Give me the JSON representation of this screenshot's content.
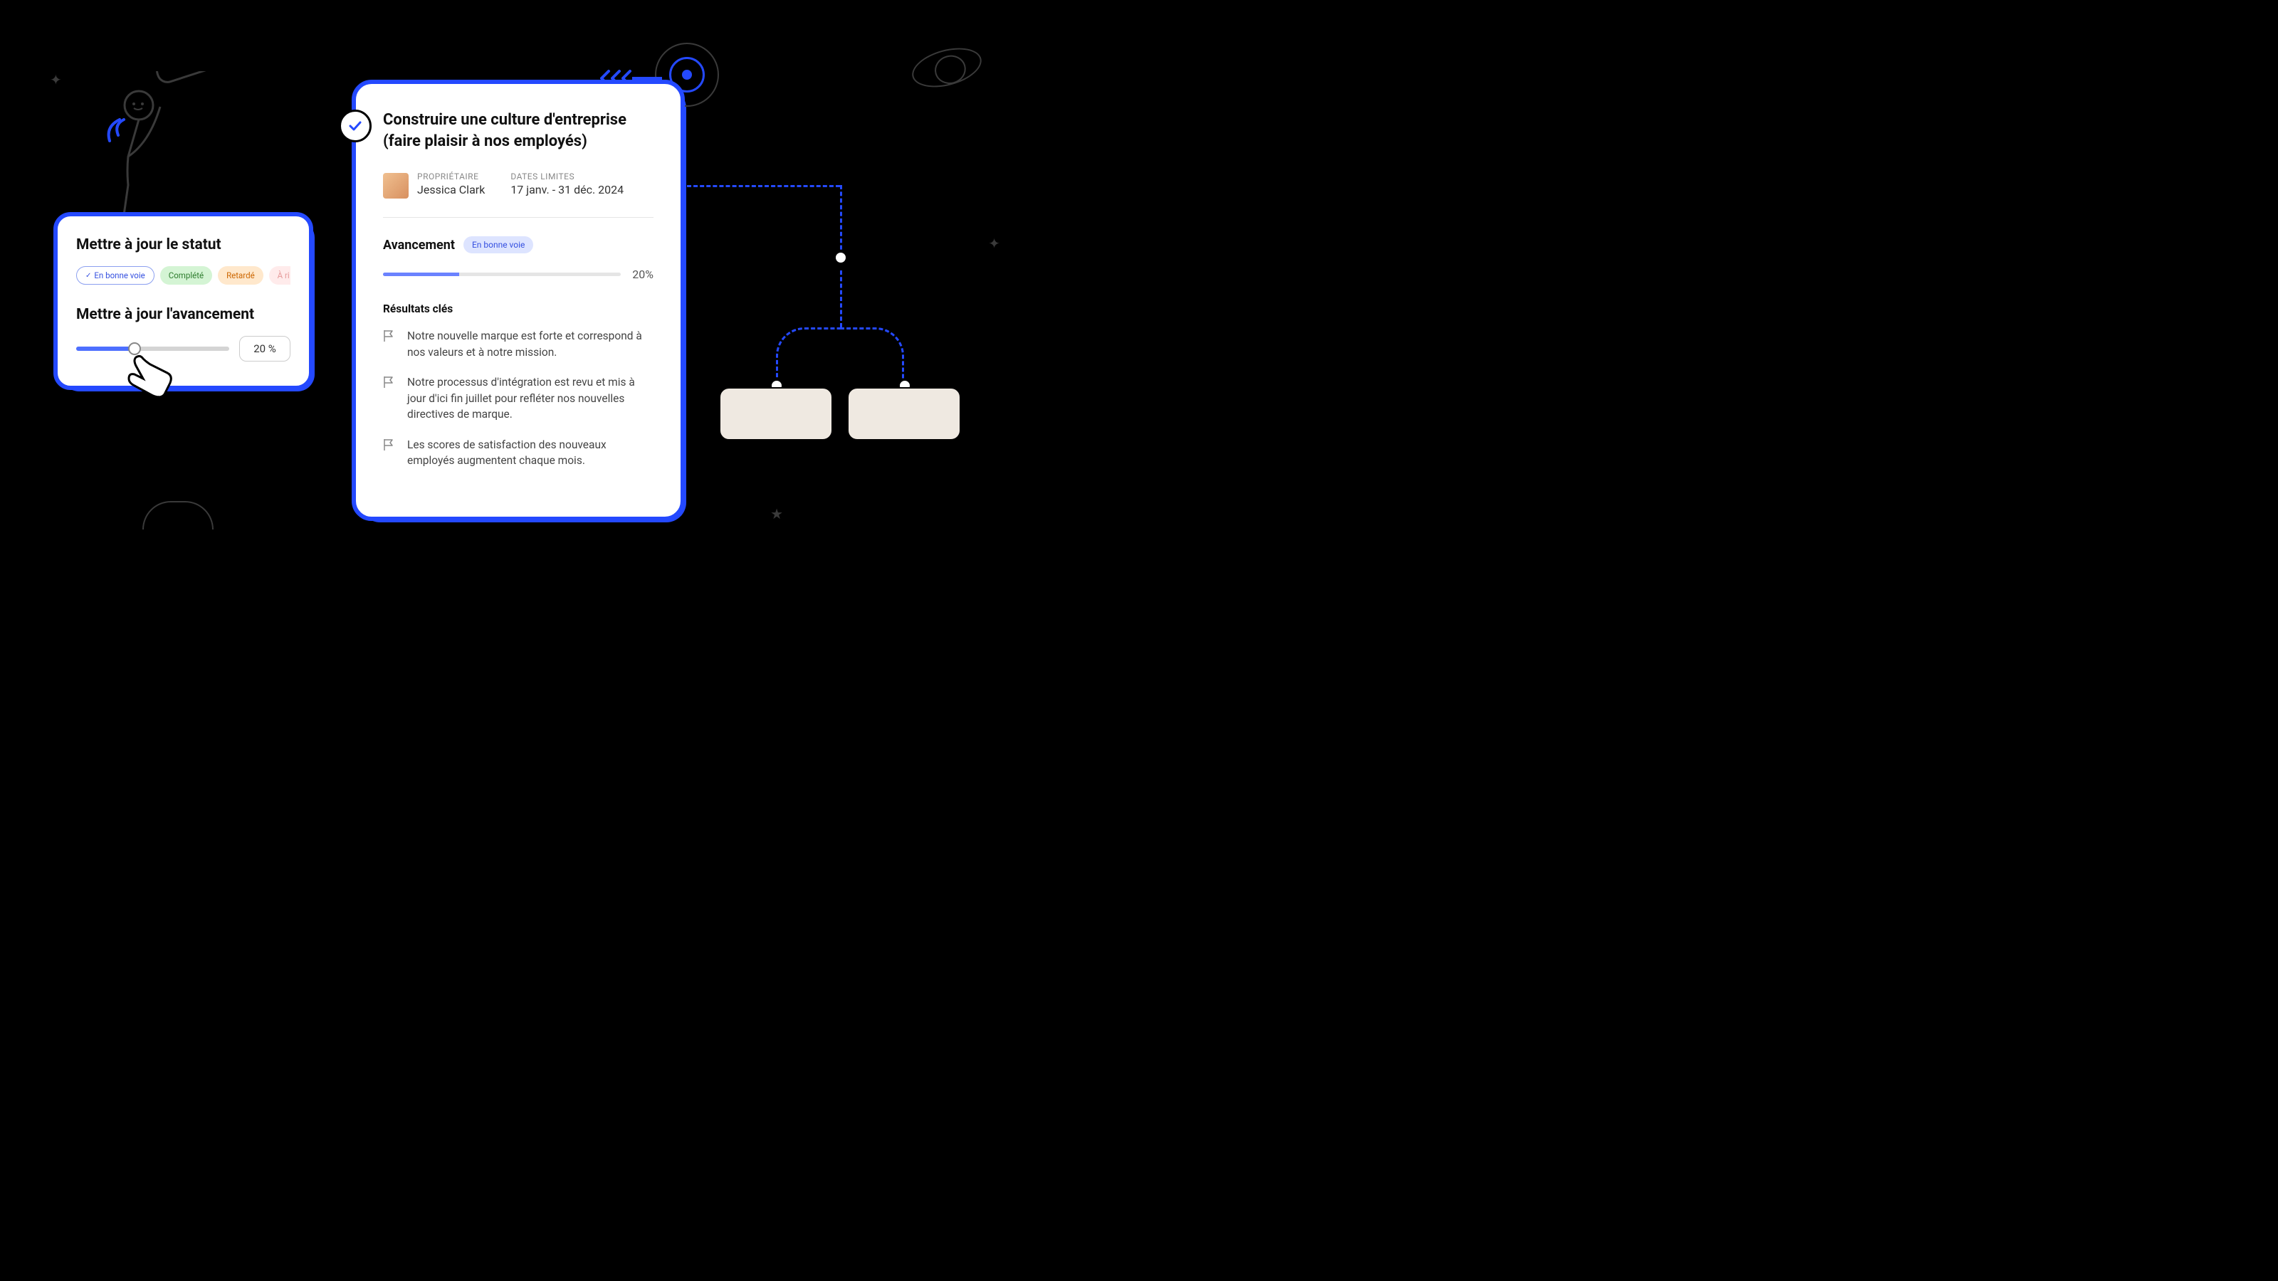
{
  "colors": {
    "accent": "#2449ff",
    "ontrack_bg": "#dde4ff",
    "ontrack_fg": "#3651e0"
  },
  "left_panel": {
    "status_heading": "Mettre à jour le statut",
    "pills": {
      "ontrack": "En bonne voie",
      "complete": "Complété",
      "late": "Retardé",
      "risk": "À ri"
    },
    "progress_heading": "Mettre à jour l'avancement",
    "progress_value": "20 %",
    "slider_percent": 36
  },
  "main_card": {
    "title": "Construire une culture d'entreprise (faire plaisir à nos employés)",
    "owner_label": "PROPRIÉTAIRE",
    "owner_name": "Jessica Clark",
    "dates_label": "DATES LIMITES",
    "dates_value": "17 janv. - 31 déc. 2024",
    "progress_heading": "Avancement",
    "status_badge": "En bonne voie",
    "progress_pct": "20%",
    "bar_fill_pct": 32,
    "kr_heading": "Résultats clés",
    "kr": [
      "Notre nouvelle marque est forte et correspond à nos valeurs et à notre mission.",
      "Notre processus d'intégration est revu et mis à jour d'ici fin juillet pour refléter nos nouvelles directives de marque.",
      "Les scores de satisfaction des nouveaux employés augmentent chaque mois."
    ]
  }
}
